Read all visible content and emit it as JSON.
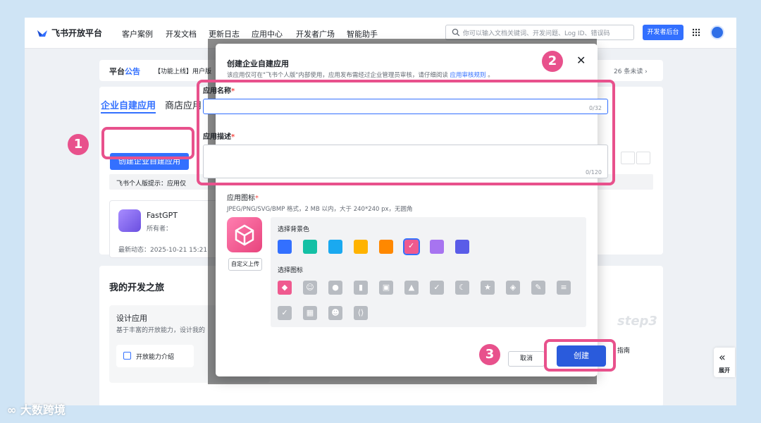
{
  "nav": {
    "logo": "飞书开放平台",
    "items": [
      "客户案例",
      "开发文档",
      "更新日志",
      "应用中心",
      "开发者广场",
      "智能助手"
    ],
    "search_placeholder": "你可以输入文档关键词、开发问题、Log ID、错误码",
    "dev_console": "开发者后台"
  },
  "announcement": {
    "title_a": "平台",
    "title_b": "公告",
    "text": "【功能上线】用户版",
    "unread": "26 条未读 ›"
  },
  "apps": {
    "tab_active": "企业自建应用",
    "tab_2": "商店应用",
    "create_button": "创建企业自建应用",
    "hint": "飞书个人版提示：应用仅",
    "card": {
      "name": "FastGPT",
      "owner": "所有者：",
      "last": "最新动态：2025-10-21 15:21"
    }
  },
  "journey": {
    "title": "我的开发之旅",
    "step_title": "设计应用",
    "step_desc": "基于丰富的开放能力，设计我的",
    "step_link": "开放能力介绍",
    "step3": "step3",
    "guide": "指南"
  },
  "expand_label": "展开",
  "modal": {
    "title": "创建企业自建应用",
    "subtitle": "该应用仅可在\"飞书个人版\"内部使用，应用发布需经过企业管理员审核，请仔细阅读",
    "subtitle_link": "应用审核规则",
    "subtitle_end": "。",
    "name_label": "应用名称",
    "name_counter": "0/32",
    "desc_label": "应用描述",
    "desc_counter": "0/120",
    "icon_label": "应用图标",
    "icon_hint": "JPEG/PNG/SVG/BMP 格式，2 MB 以内，大于 240*240 px，无圆角",
    "upload_button": "自定义上传",
    "bg_label": "选择背景色",
    "icon_pick_label": "选择图标",
    "bg_colors": [
      "#3370ff",
      "#14c0a5",
      "#1aa9f0",
      "#ffb300",
      "#ff8800",
      "#ef5a8f",
      "#a774f0",
      "#5a5ce8"
    ],
    "selected_color_index": 5,
    "cancel": "取消",
    "create": "创建"
  },
  "callouts": [
    "1",
    "2",
    "3"
  ],
  "watermark": "大数跨境"
}
